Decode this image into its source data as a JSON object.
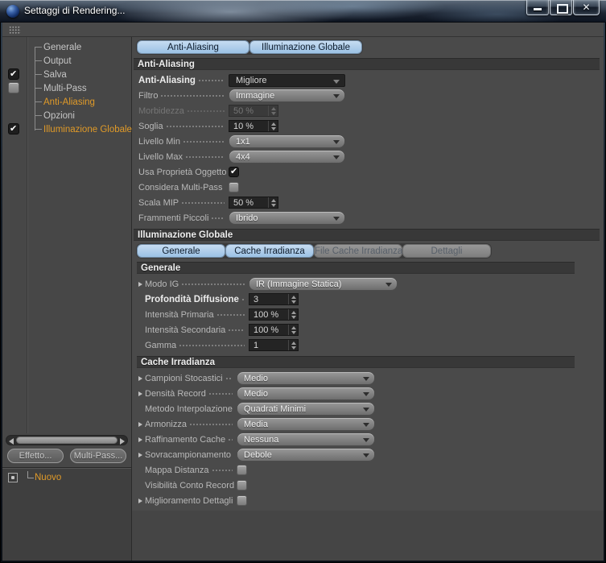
{
  "window": {
    "title": "Settaggi di Rendering..."
  },
  "colors": {
    "accent_orange": "#E09A28",
    "tab_active_blue": "#A9CBE8",
    "tab_inactive_gray": "#8A8A8A",
    "panel_bg": "#474747",
    "field_bg": "#242424"
  },
  "sidebar": {
    "items": [
      {
        "label": "Generale",
        "checkbox": "none",
        "active": false
      },
      {
        "label": "Output",
        "checkbox": "none",
        "active": false
      },
      {
        "label": "Salva",
        "checkbox": "checked",
        "active": false
      },
      {
        "label": "Multi-Pass",
        "checkbox": "unchecked",
        "active": false
      },
      {
        "label": "Anti-Aliasing",
        "checkbox": "none",
        "active": true
      },
      {
        "label": "Opzioni",
        "checkbox": "none",
        "active": false
      },
      {
        "label": "Illuminazione Globale",
        "checkbox": "checked",
        "active": true
      }
    ],
    "effect_button": "Effetto...",
    "multipass_button": "Multi-Pass...",
    "preset_item": "Nuovo"
  },
  "top_tabs": [
    {
      "label": "Anti-Aliasing",
      "active": true
    },
    {
      "label": "Illuminazione Globale",
      "active": true
    }
  ],
  "aa": {
    "header": "Anti-Aliasing",
    "rows": [
      {
        "label": "Anti-Aliasing",
        "type": "dropdown",
        "value": "Migliore",
        "bold": true
      },
      {
        "label": "Filtro",
        "type": "dropdown",
        "value": "Immagine"
      },
      {
        "label": "Morbidezza",
        "type": "number",
        "value": "50 %",
        "disabled": true
      },
      {
        "label": "Soglia",
        "type": "number",
        "value": "10 %"
      },
      {
        "label": "Livello Min",
        "type": "dropdown",
        "value": "1x1"
      },
      {
        "label": "Livello Max",
        "type": "dropdown",
        "value": "4x4"
      },
      {
        "label": "Usa Proprietà Oggetto",
        "type": "checkbox",
        "checked": true
      },
      {
        "label": "Considera Multi-Pass",
        "type": "checkbox",
        "checked": false
      },
      {
        "label": "Scala MIP",
        "type": "number",
        "value": "50 %"
      },
      {
        "label": "Frammenti Piccoli",
        "type": "dropdown",
        "value": "Ibrido"
      }
    ]
  },
  "ig": {
    "header": "Illuminazione Globale",
    "tabs": [
      {
        "label": "Generale",
        "active": true
      },
      {
        "label": "Cache Irradianza",
        "active": true
      },
      {
        "label": "File Cache Irradianza",
        "active": false
      },
      {
        "label": "Dettagli",
        "active": false
      }
    ],
    "generale": {
      "header": "Generale",
      "rows": [
        {
          "label": "Modo IG",
          "type": "dropdown",
          "value": "IR (Immagine Statica)",
          "arrow": true
        },
        {
          "label": "Profondità Diffusione",
          "type": "number",
          "value": "3",
          "bold": true
        },
        {
          "label": "Intensità Primaria",
          "type": "number",
          "value": "100 %"
        },
        {
          "label": "Intensità Secondaria",
          "type": "number",
          "value": "100 %"
        },
        {
          "label": "Gamma",
          "type": "number",
          "value": "1"
        }
      ]
    },
    "cache": {
      "header": "Cache Irradianza",
      "rows": [
        {
          "label": "Campioni Stocastici",
          "type": "dropdown",
          "value": "Medio",
          "arrow": true
        },
        {
          "label": "Densità Record",
          "type": "dropdown",
          "value": "Medio",
          "arrow": true
        },
        {
          "label": "Metodo Interpolazione",
          "type": "dropdown",
          "value": "Quadrati Minimi",
          "arrow": false
        },
        {
          "label": "Armonizza",
          "type": "dropdown",
          "value": "Media",
          "arrow": true
        },
        {
          "label": "Raffinamento Cache",
          "type": "dropdown",
          "value": "Nessuna",
          "arrow": true
        },
        {
          "label": "Sovracampionamento",
          "type": "dropdown",
          "value": "Debole",
          "arrow": true
        },
        {
          "label": "Mappa Distanza",
          "type": "checkbox",
          "checked": false,
          "arrow": false
        },
        {
          "label": "Visibilità Conto Record",
          "type": "checkbox",
          "checked": false,
          "arrow": false
        },
        {
          "label": "Miglioramento Dettagli",
          "type": "checkbox",
          "checked": false,
          "arrow": true
        }
      ]
    }
  }
}
